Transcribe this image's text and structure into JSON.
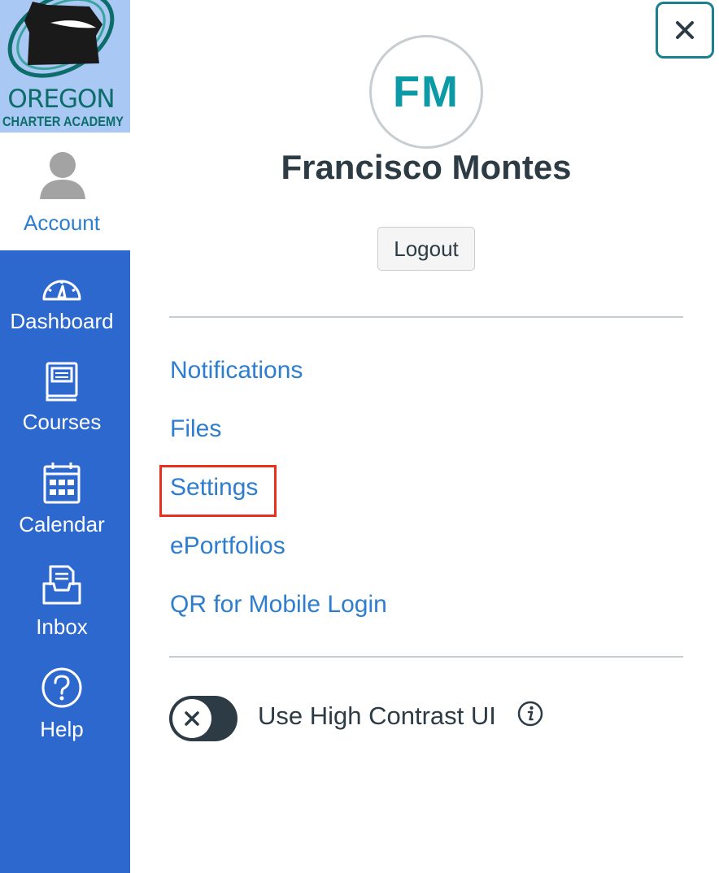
{
  "colors": {
    "nav_bg": "#2d68cf",
    "logo_bg": "#a9c8f3",
    "link": "#2d7ecf",
    "text_dark": "#2d3b45",
    "avatar_initials": "#0b9aa6",
    "close_border": "#1a7f8e",
    "highlight": "#e8301c"
  },
  "logo": {
    "line1": "OREGON",
    "line2": "CHARTER ACADEMY"
  },
  "nav": {
    "account_label": "Account",
    "items": [
      {
        "label": "Dashboard",
        "icon": "dashboard-icon"
      },
      {
        "label": "Courses",
        "icon": "courses-icon"
      },
      {
        "label": "Calendar",
        "icon": "calendar-icon"
      },
      {
        "label": "Inbox",
        "icon": "inbox-icon"
      },
      {
        "label": "Help",
        "icon": "help-icon"
      }
    ]
  },
  "tray": {
    "close_icon": "close-icon",
    "avatar_initials": "FM",
    "user_name": "Francisco Montes",
    "logout_label": "Logout",
    "links": [
      "Notifications",
      "Files",
      "Settings",
      "ePortfolios",
      "QR for Mobile Login"
    ],
    "highlighted_link": "Settings",
    "high_contrast": {
      "label": "Use High Contrast UI",
      "enabled": false,
      "info_icon": "info-icon"
    }
  }
}
